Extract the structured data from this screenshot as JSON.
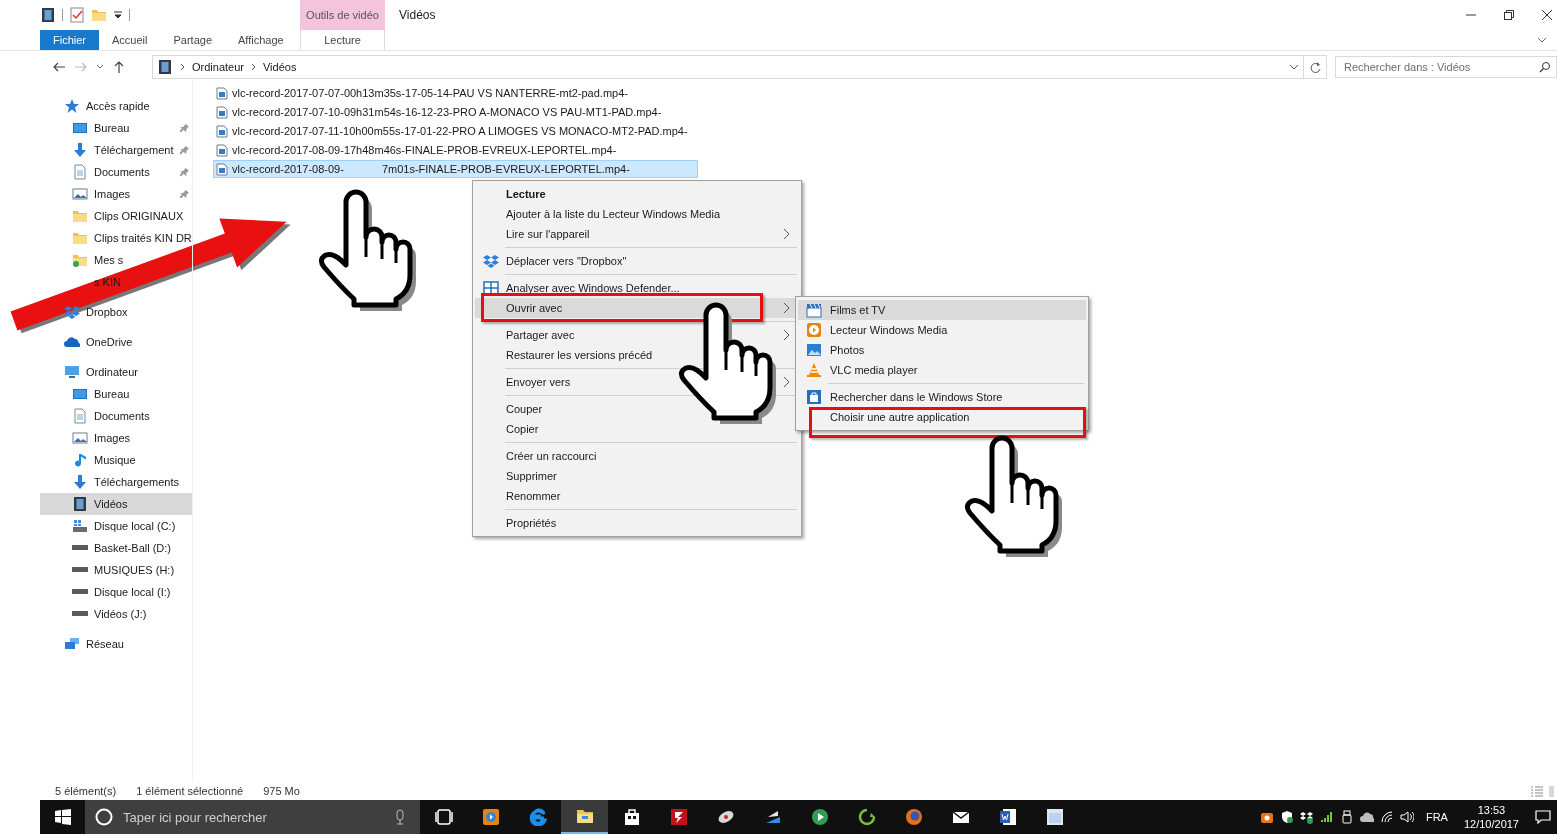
{
  "ribbon": {
    "contextual_group": "Outils de vidéo",
    "window_title": "Vidéos",
    "tabs": [
      {
        "label": "Fichier",
        "kind": "file"
      },
      {
        "label": "Accueil",
        "kind": "normal"
      },
      {
        "label": "Partage",
        "kind": "normal"
      },
      {
        "label": "Affichage",
        "kind": "normal"
      },
      {
        "label": "Lecture",
        "kind": "contextual"
      }
    ]
  },
  "address_bar": {
    "path": [
      "Ordinateur",
      "Vidéos"
    ]
  },
  "search": {
    "placeholder": "Rechercher dans : Vidéos"
  },
  "sidebar": {
    "items": [
      {
        "label": "Accès rapide",
        "kind": "star",
        "pinned": false,
        "selected": false,
        "children": [
          {
            "label": "Bureau",
            "kind": "desktop",
            "pinned": true,
            "selected": false
          },
          {
            "label": "Téléchargement",
            "kind": "download",
            "pinned": true,
            "selected": false
          },
          {
            "label": "Documents",
            "kind": "document",
            "pinned": true,
            "selected": false
          },
          {
            "label": "Images",
            "kind": "images",
            "pinned": true,
            "selected": false
          },
          {
            "label": "Clips ORIGINAUX",
            "kind": "folder",
            "pinned": false,
            "selected": false
          },
          {
            "label": "Clips traités KIN DR",
            "kind": "folder",
            "pinned": false,
            "selected": false
          },
          {
            "label": "Mes s",
            "kind": "synced-folder",
            "pinned": false,
            "selected": false
          },
          {
            "label": "s KIN",
            "kind": "hidden",
            "pinned": false,
            "selected": false
          }
        ]
      },
      {
        "label": "Dropbox",
        "kind": "dropbox",
        "pinned": false,
        "selected": false
      },
      {
        "label": "OneDrive",
        "kind": "onedrive",
        "pinned": false,
        "selected": false
      },
      {
        "label": "Ordinateur",
        "kind": "computer",
        "pinned": false,
        "selected": false,
        "children": [
          {
            "label": "Bureau",
            "kind": "desktop",
            "pinned": false,
            "selected": false
          },
          {
            "label": "Documents",
            "kind": "document",
            "pinned": false,
            "selected": false
          },
          {
            "label": "Images",
            "kind": "images",
            "pinned": false,
            "selected": false
          },
          {
            "label": "Musique",
            "kind": "music",
            "pinned": false,
            "selected": false
          },
          {
            "label": "Téléchargements",
            "kind": "download",
            "pinned": false,
            "selected": false
          },
          {
            "label": "Vidéos",
            "kind": "videos",
            "pinned": false,
            "selected": true
          },
          {
            "label": "Disque local (C:)",
            "kind": "drive-system",
            "pinned": false,
            "selected": false
          },
          {
            "label": "Basket-Ball (D:)",
            "kind": "drive",
            "pinned": false,
            "selected": false
          },
          {
            "label": "MUSIQUES (H:)",
            "kind": "drive",
            "pinned": false,
            "selected": false
          },
          {
            "label": "Disque local (I:)",
            "kind": "drive",
            "pinned": false,
            "selected": false
          },
          {
            "label": "Vidéos (J:)",
            "kind": "drive",
            "pinned": false,
            "selected": false
          }
        ]
      },
      {
        "label": "Réseau",
        "kind": "network",
        "pinned": false,
        "selected": false
      }
    ]
  },
  "files": [
    {
      "name_parts": [
        "vlc-record-2017-07-07-00h13m35s-17-05-14-PAU VS NANTERRE-mt2-pad.mp4-"
      ],
      "selected": false
    },
    {
      "name_parts": [
        "vlc-record-2017-07-10-09h31m54s-16-12-23-PRO A-MONACO VS PAU-MT1-PAD.mp4-"
      ],
      "selected": false
    },
    {
      "name_parts": [
        "vlc-record-2017-07-11-10h00m55s-17-01-22-PRO A LIMOGES VS MONACO-MT2-PAD.mp4-"
      ],
      "selected": false
    },
    {
      "name_parts": [
        "vlc-record-2017-08-09-17h48m46s-FINALE-PROB-EVREUX-LEPORTEL.mp4-"
      ],
      "selected": false
    },
    {
      "name_parts": [
        "vlc-record-2017-08-09-",
        "7m01s-FINALE-PROB-EVREUX-LEPORTEL.mp4-"
      ],
      "selected": true
    }
  ],
  "context_menu": {
    "items": [
      {
        "kind": "plain",
        "label": "Lecture",
        "bold": true,
        "submenu": false,
        "highlighted": false,
        "framed": false
      },
      {
        "kind": "plain",
        "label": "Ajouter à la liste du Lecteur Windows Media",
        "bold": false,
        "submenu": false,
        "highlighted": false,
        "framed": false
      },
      {
        "kind": "plain",
        "label": "Lire sur l'appareil",
        "bold": false,
        "submenu": true,
        "highlighted": false,
        "framed": false
      },
      {
        "kind": "separator"
      },
      {
        "kind": "dropbox",
        "label": "Déplacer vers \"Dropbox\"",
        "bold": false,
        "submenu": false,
        "highlighted": false,
        "framed": false
      },
      {
        "kind": "separator"
      },
      {
        "kind": "defender",
        "label": "Analyser avec Windows Defender...",
        "bold": false,
        "submenu": false,
        "highlighted": false,
        "framed": false
      },
      {
        "kind": "plain",
        "label": "Ouvrir avec",
        "bold": false,
        "submenu": true,
        "highlighted": true,
        "framed": true
      },
      {
        "kind": "separator"
      },
      {
        "kind": "plain",
        "label": "Partager avec",
        "bold": false,
        "submenu": true,
        "highlighted": false,
        "framed": false
      },
      {
        "kind": "plain",
        "label": "Restaurer les versions précéd",
        "bold": false,
        "submenu": false,
        "highlighted": false,
        "framed": false
      },
      {
        "kind": "separator"
      },
      {
        "kind": "plain",
        "label": "Envoyer vers",
        "bold": false,
        "submenu": true,
        "highlighted": false,
        "framed": false
      },
      {
        "kind": "separator"
      },
      {
        "kind": "plain",
        "label": "Couper",
        "bold": false,
        "submenu": false,
        "highlighted": false,
        "framed": false
      },
      {
        "kind": "plain",
        "label": "Copier",
        "bold": false,
        "submenu": false,
        "highlighted": false,
        "framed": false
      },
      {
        "kind": "separator"
      },
      {
        "kind": "plain",
        "label": "Créer un raccourci",
        "bold": false,
        "submenu": false,
        "highlighted": false,
        "framed": false
      },
      {
        "kind": "plain",
        "label": "Supprimer",
        "bold": false,
        "submenu": false,
        "highlighted": false,
        "framed": false
      },
      {
        "kind": "plain",
        "label": "Renommer",
        "bold": false,
        "submenu": false,
        "highlighted": false,
        "framed": false
      },
      {
        "kind": "separator"
      },
      {
        "kind": "plain",
        "label": "Propriétés",
        "bold": false,
        "submenu": false,
        "highlighted": false,
        "framed": false
      }
    ]
  },
  "open_with_menu": {
    "items": [
      {
        "kind": "films",
        "label": "Films et TV",
        "bold": false,
        "submenu": false,
        "highlighted": true,
        "framed": false
      },
      {
        "kind": "wmp",
        "label": "Lecteur Windows Media",
        "bold": false,
        "submenu": false,
        "highlighted": false,
        "framed": false
      },
      {
        "kind": "photos",
        "label": "Photos",
        "bold": false,
        "submenu": false,
        "highlighted": false,
        "framed": false
      },
      {
        "kind": "vlc",
        "label": "VLC media player",
        "bold": false,
        "submenu": false,
        "highlighted": false,
        "framed": false
      },
      {
        "kind": "separator"
      },
      {
        "kind": "store",
        "label": "Rechercher dans le Windows Store",
        "bold": false,
        "submenu": false,
        "highlighted": false,
        "framed": false
      },
      {
        "kind": "plain",
        "label": "Choisir une autre application",
        "bold": false,
        "submenu": false,
        "highlighted": false,
        "framed": true
      }
    ]
  },
  "status_bar": {
    "count": "5 élément(s)",
    "selection": "1 élément sélectionné",
    "size": "975 Mo"
  },
  "taskbar": {
    "search_placeholder": "Taper ici pour rechercher",
    "apps": [
      {
        "kind": "task-view",
        "active": false
      },
      {
        "kind": "media-player",
        "active": false
      },
      {
        "kind": "edge",
        "active": false
      },
      {
        "kind": "explorer",
        "active": true
      },
      {
        "kind": "store",
        "active": false
      },
      {
        "kind": "filezilla",
        "active": false
      },
      {
        "kind": "satellite",
        "active": false
      },
      {
        "kind": "cloud-app",
        "active": false
      },
      {
        "kind": "green-play",
        "active": false
      },
      {
        "kind": "recycle",
        "active": false
      },
      {
        "kind": "firefox",
        "active": false
      },
      {
        "kind": "mail",
        "active": false
      },
      {
        "kind": "word",
        "active": false
      },
      {
        "kind": "calculator",
        "active": false
      }
    ],
    "language": "FRA",
    "time": "13:53",
    "date": "12/10/2017"
  }
}
